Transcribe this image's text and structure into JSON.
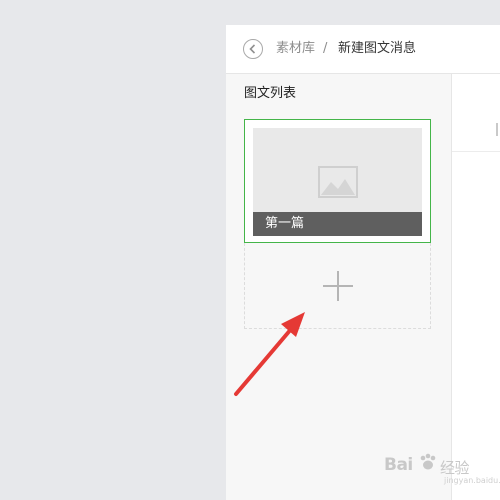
{
  "breadcrumb": {
    "back_icon": "chevron-left-circle-icon",
    "parent": "素材库",
    "separator": "/",
    "current": "新建图文消息"
  },
  "article_list": {
    "title": "图文列表",
    "items": [
      {
        "title": "第一篇",
        "thumbnail_icon": "image-placeholder-icon",
        "selected": true
      }
    ],
    "add_icon": "plus-icon"
  },
  "annotation": {
    "arrow_color": "#e53935"
  },
  "watermark": {
    "text_left": "Bai",
    "text_right": "经验",
    "sub": "jingyan.baidu.com"
  },
  "colors": {
    "accent": "#44b549",
    "title_bar": "#5f5f5f"
  }
}
